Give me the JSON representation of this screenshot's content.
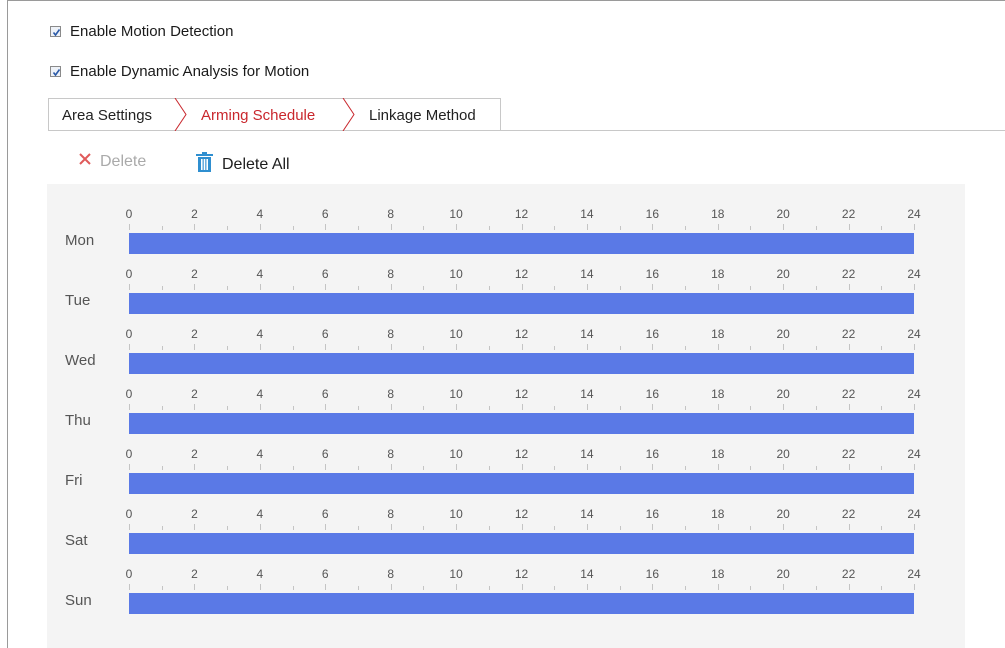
{
  "options": {
    "enable_motion_detection": {
      "label": "Enable Motion Detection",
      "checked": true
    },
    "enable_dynamic_analysis": {
      "label": "Enable Dynamic Analysis for Motion",
      "checked": true
    }
  },
  "tabs": [
    {
      "label": "Area Settings",
      "active": false
    },
    {
      "label": "Arming Schedule",
      "active": true
    },
    {
      "label": "Linkage Method",
      "active": false
    }
  ],
  "toolbar": {
    "delete_label": "Delete",
    "delete_enabled": false,
    "delete_all_label": "Delete All"
  },
  "schedule": {
    "hour_labels": [
      "0",
      "2",
      "4",
      "6",
      "8",
      "10",
      "12",
      "14",
      "16",
      "18",
      "20",
      "22",
      "24"
    ],
    "days": [
      {
        "label": "Mon",
        "start": 0,
        "end": 24
      },
      {
        "label": "Tue",
        "start": 0,
        "end": 24
      },
      {
        "label": "Wed",
        "start": 0,
        "end": 24
      },
      {
        "label": "Thu",
        "start": 0,
        "end": 24
      },
      {
        "label": "Fri",
        "start": 0,
        "end": 24
      },
      {
        "label": "Sat",
        "start": 0,
        "end": 24
      },
      {
        "label": "Sun",
        "start": 0,
        "end": 24
      }
    ]
  },
  "colors": {
    "active_tab": "#c9272d",
    "schedule_bar": "#5a79e6",
    "delete_all_icon": "#2f8fd0",
    "delete_icon": "#e05a5a"
  }
}
